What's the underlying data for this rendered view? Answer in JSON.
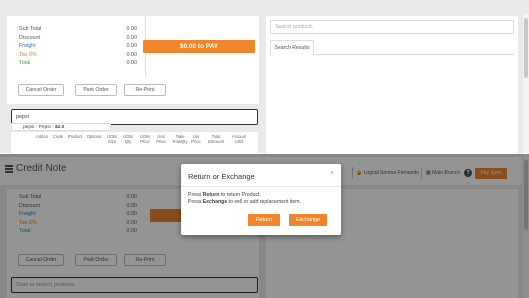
{
  "top": {
    "totals": [
      {
        "label": "Sub Total",
        "value": "0.00",
        "tone": "default"
      },
      {
        "label": "Discount",
        "value": "0.00",
        "tone": "default"
      },
      {
        "label": "Freight",
        "value": "0.00",
        "tone": "blue"
      },
      {
        "label": "Tax 0%",
        "value": "0.00",
        "tone": "orange"
      },
      {
        "label": "Total",
        "value": "0.00",
        "tone": "green"
      }
    ],
    "pay_label": "$0.00 to PAY",
    "buttons": {
      "cancel": "Cancel Order",
      "park": "Park Order",
      "reprint": "Re-Print"
    },
    "search_value": "pepsi",
    "suggestion": {
      "name": "pepsi - Pepsi - ",
      "price": "$2.0"
    },
    "table_headers": {
      "addon": "Addon",
      "code": "Code",
      "product": "Product",
      "options": "Options",
      "uom_size": "UOM Size",
      "uom_qty": "UOM Qty",
      "uom_price": "UOM Price",
      "unit_price": "Unit Price",
      "take_row_qty": "Take RowQty",
      "uni_price": "Uni Price",
      "total_discount": "Total Discount",
      "amount_usd": "Amount USD"
    },
    "product_search_placeholder": "Search products",
    "search_results_tab": "Search Results"
  },
  "bottom": {
    "title": "Credit Note",
    "header": {
      "logout": "Logout",
      "user": "Serena Fernando",
      "branch": "Main Branch",
      "pay_sync": "Pay Sync"
    },
    "totals": [
      {
        "label": "Sub Total",
        "value": "0.00",
        "tone": "default"
      },
      {
        "label": "Discount",
        "value": "0.00",
        "tone": "default"
      },
      {
        "label": "Freight",
        "value": "0.00",
        "tone": "blue"
      },
      {
        "label": "Tax 0%",
        "value": "0.00",
        "tone": "orange"
      },
      {
        "label": "Total",
        "value": "0.00",
        "tone": "green"
      }
    ],
    "buttons": {
      "cancel": "Cancel Order",
      "park": "Park Order",
      "reprint": "Re-Print"
    },
    "search_placeholder": "Scan or search products",
    "modal": {
      "title": "Return or Exchange",
      "close": "×",
      "line1_pre": "Press ",
      "line1_key": "Return",
      "line1_post": " to return Product.",
      "line2_pre": "Press ",
      "line2_key": "Exchange",
      "line2_post": " to sell or add replacement item.",
      "return_label": "Return",
      "exchange_label": "Exchange"
    }
  },
  "colors": {
    "accent": "#f0852b",
    "freight": "#2a6fc9",
    "tax": "#e07a1a",
    "total": "#3aa63a"
  }
}
